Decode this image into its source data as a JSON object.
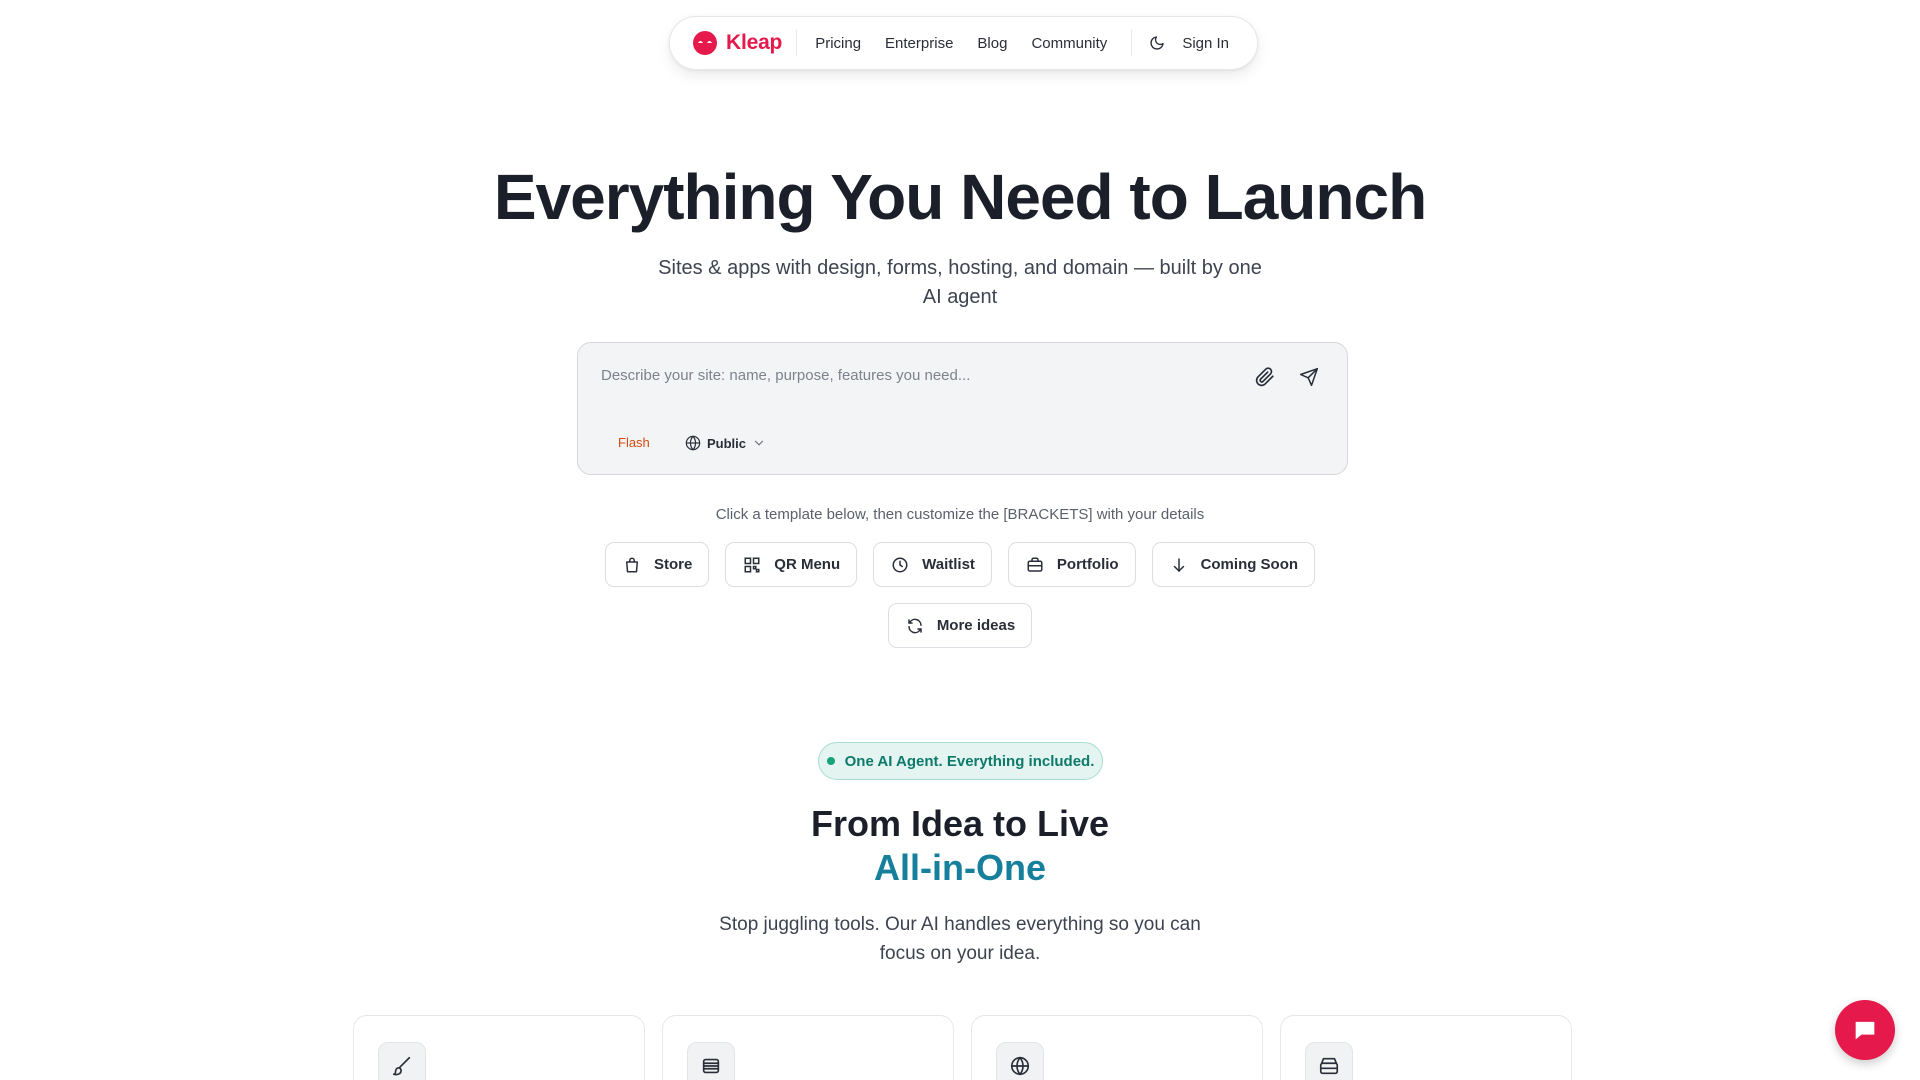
{
  "colors": {
    "brand": "#e5194b",
    "accent_teal": "#16809c",
    "flash": "#d14a10"
  },
  "nav": {
    "brand": "Kleap",
    "links": [
      "Pricing",
      "Enterprise",
      "Blog",
      "Community"
    ],
    "theme_icon": "moon-icon",
    "signin": "Sign In"
  },
  "hero": {
    "title": "Everything You Need to Launch",
    "subtitle": "Sites & apps with design, forms, hosting, and domain — built by one AI agent"
  },
  "prompt": {
    "placeholder": "Describe your site: name, purpose, features you need...",
    "value": "",
    "mode": "Flash",
    "visibility": "Public"
  },
  "hint": "Click a template below, then customize the [BRACKETS] with your details",
  "templates": [
    {
      "label": "Store",
      "icon": "shopping-bag-icon"
    },
    {
      "label": "QR Menu",
      "icon": "qr-code-icon"
    },
    {
      "label": "Waitlist",
      "icon": "clock-icon"
    },
    {
      "label": "Portfolio",
      "icon": "briefcase-icon"
    },
    {
      "label": "Coming Soon",
      "icon": "arrow-down-icon"
    }
  ],
  "more_ideas": {
    "label": "More ideas",
    "icon": "refresh-icon"
  },
  "section": {
    "pill": "One AI Agent. Everything included.",
    "title_line1": "From Idea to Live",
    "title_line2": "All-in-One",
    "subtitle": "Stop juggling tools. Our AI handles everything so you can focus on your idea."
  },
  "feature_icons": [
    "brush-icon",
    "list-icon",
    "globe-icon",
    "database-icon"
  ]
}
